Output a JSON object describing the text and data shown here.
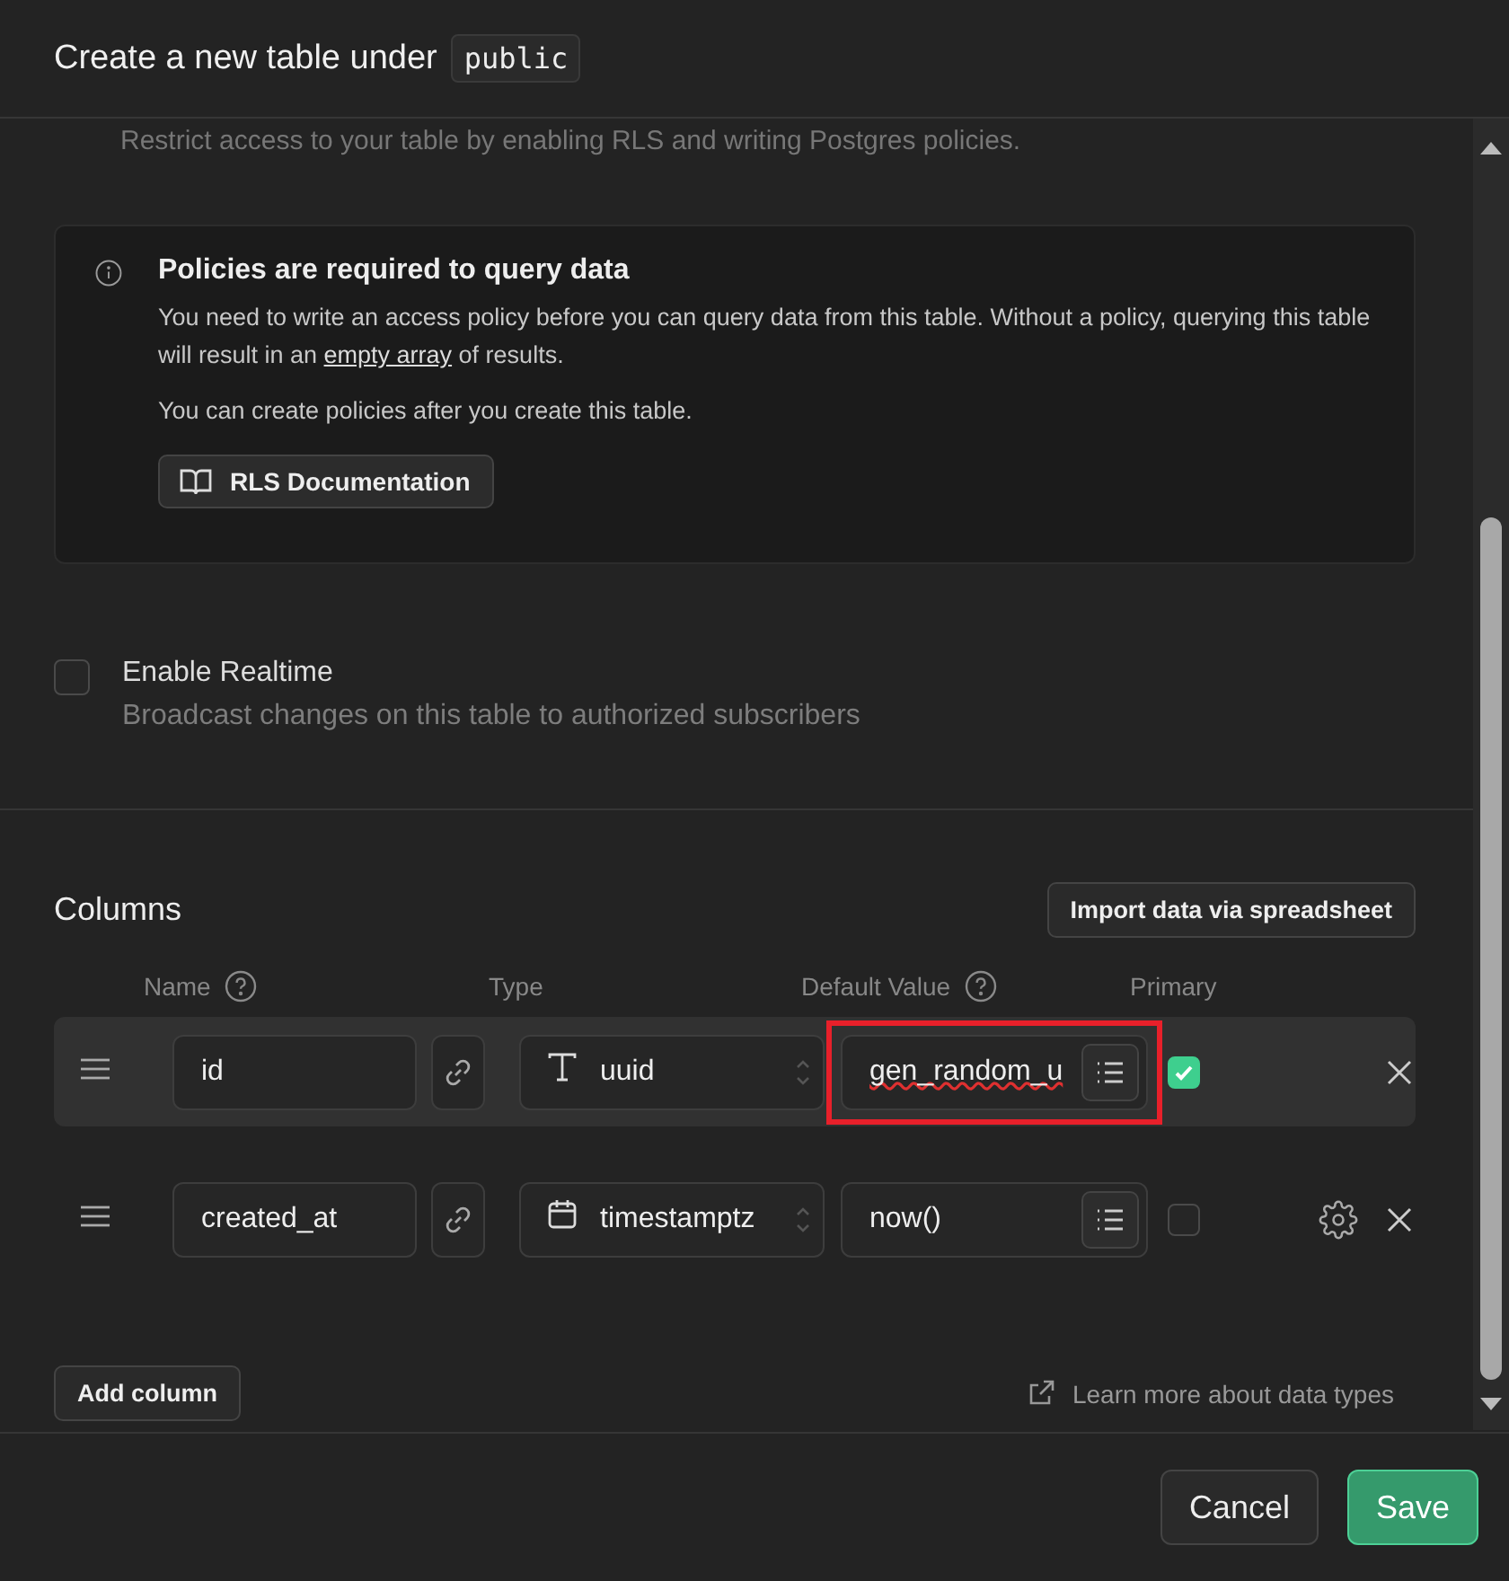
{
  "header": {
    "title": "Create a new table under",
    "schema": "public"
  },
  "rls_description": "Restrict access to your table by enabling RLS and writing Postgres policies.",
  "notice": {
    "title": "Policies are required to query data",
    "text_before": "You need to write an access policy before you can query data from this table. Without a policy, querying this table will result in an ",
    "link": "empty array",
    "text_after": " of results.",
    "note": "You can create policies after you create this table.",
    "button": "RLS Documentation"
  },
  "realtime": {
    "label": "Enable Realtime",
    "description": "Broadcast changes on this table to authorized subscribers",
    "checked": false
  },
  "columns_section": {
    "title": "Columns",
    "import_button": "Import data via spreadsheet",
    "headers": [
      {
        "label": "Name",
        "help": true
      },
      {
        "label": "Type",
        "help": false
      },
      {
        "label": "Default Value",
        "help": true
      },
      {
        "label": "Primary",
        "help": false
      }
    ],
    "rows": [
      {
        "name": "id",
        "type": "uuid",
        "kind": "text",
        "default": "gen_random_u",
        "misspelled": true,
        "highlighted": true,
        "primary": true,
        "settings": false,
        "selected": true
      },
      {
        "name": "created_at",
        "type": "timestamptz",
        "kind": "date",
        "default": "now()",
        "misspelled": false,
        "highlighted": false,
        "primary": false,
        "settings": true,
        "selected": false
      }
    ],
    "add_button": "Add column",
    "learn_link": "Learn more about data types"
  },
  "footer": {
    "cancel": "Cancel",
    "save": "Save"
  }
}
